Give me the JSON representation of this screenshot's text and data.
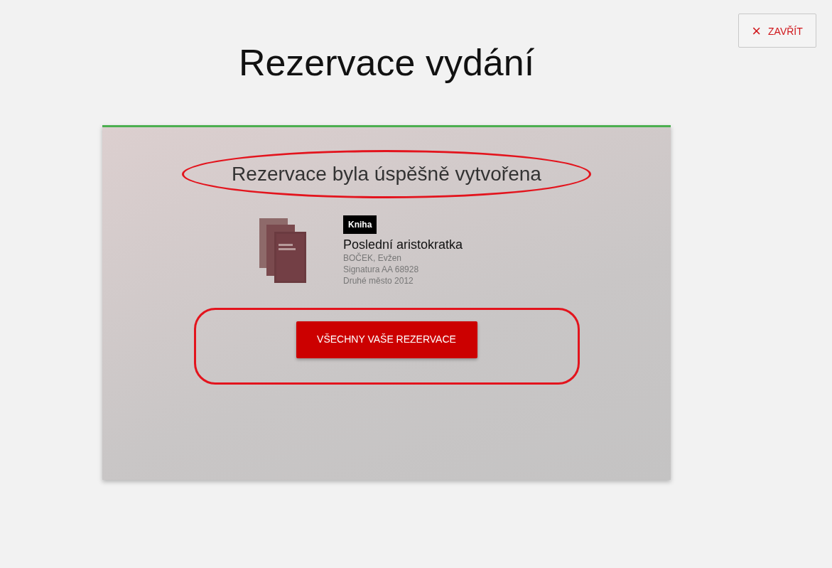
{
  "close_button": {
    "icon": "×",
    "label": "ZAVŘÍT"
  },
  "title": "Rezervace vydání",
  "result": {
    "message": "Rezervace byla úspěšně vytvořena",
    "message_annotated": true,
    "item": {
      "type_badge": "Kniha",
      "name": "Poslední aristokratka",
      "author": "BOČEK, Evžen",
      "signature": "Signatura AA 68928",
      "publisher": "Druhé město 2012"
    },
    "action_button": "VŠECHNY VAŠE REZERVACE",
    "action_annotated": true
  }
}
